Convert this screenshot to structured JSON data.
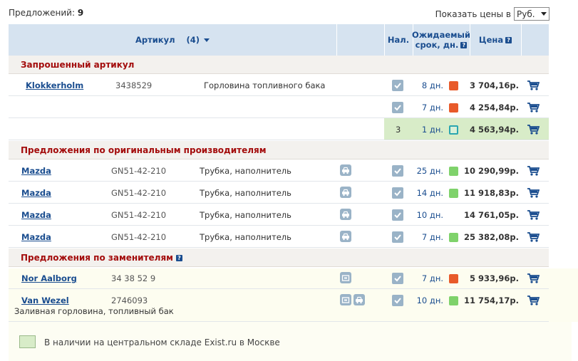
{
  "top": {
    "offers_label": "Предложений:",
    "offers_count": "9",
    "show_prices_label": "Показать цены в",
    "currency": "Руб."
  },
  "header": {
    "article": "Артикул",
    "article_count": "(4)",
    "in_stock": "Нал.",
    "expected_line1": "Ожидаемый",
    "expected_line2": "срок, дн.",
    "price": "Цена"
  },
  "sections": {
    "requested": "Запрошенный артикул",
    "original": "Предложения по оригинальным производителям",
    "substitutes": "Предложения по заменителям"
  },
  "requested_rows": [
    {
      "brand": "Klokkerholm",
      "article": "3438529",
      "desc": "Горловина топливного бака",
      "days": "8 дн.",
      "status": "red",
      "price": "3 704,16р."
    },
    {
      "brand": "",
      "article": "",
      "desc": "",
      "days": "7 дн.",
      "status": "red",
      "price": "4 254,84р."
    },
    {
      "brand": "",
      "article": "",
      "desc": "",
      "qty": "3",
      "days": "1 дн.",
      "status": "framed",
      "price": "4 563,94р."
    }
  ],
  "original_rows": [
    {
      "brand": "Mazda",
      "article": "GN51-42-210",
      "desc": "Трубка, наполнитель",
      "days": "25 дн.",
      "status": "green",
      "price": "10 290,99р."
    },
    {
      "brand": "Mazda",
      "article": "GN51-42-210",
      "desc": "Трубка, наполнитель",
      "days": "14 дн.",
      "status": "green",
      "price": "11 918,83р."
    },
    {
      "brand": "Mazda",
      "article": "GN51-42-210",
      "desc": "Трубка, наполнитель",
      "days": "10 дн.",
      "status": "none",
      "price": "14 761,05р."
    },
    {
      "brand": "Mazda",
      "article": "GN51-42-210",
      "desc": "Трубка, наполнитель",
      "days": "7 дн.",
      "status": "green",
      "price": "25 382,08р."
    }
  ],
  "substitute_rows": [
    {
      "brand": "Nor Aalborg",
      "article": "34 38 52 9",
      "desc": "",
      "days": "7 дн.",
      "status": "red",
      "price": "5 933,96р."
    },
    {
      "brand": "Van Wezel",
      "article": "2746093",
      "desc": "Заливная горловина, топливный бак",
      "days": "10 дн.",
      "status": "green",
      "price": "11 754,17р."
    }
  ],
  "legend": {
    "text": "В наличии на центральном складе Exist.ru в Москве"
  },
  "colors": {
    "header_bg": "#d6e3f0",
    "section_title": "#a30c0c",
    "link": "#1a4d8f",
    "status_red": "#e85a2a",
    "status_green": "#7fd26b",
    "highlight_row": "#d8ecc8"
  },
  "icons": [
    "cart-icon",
    "check-icon",
    "car-icon",
    "help-icon",
    "sort-caret-icon"
  ]
}
